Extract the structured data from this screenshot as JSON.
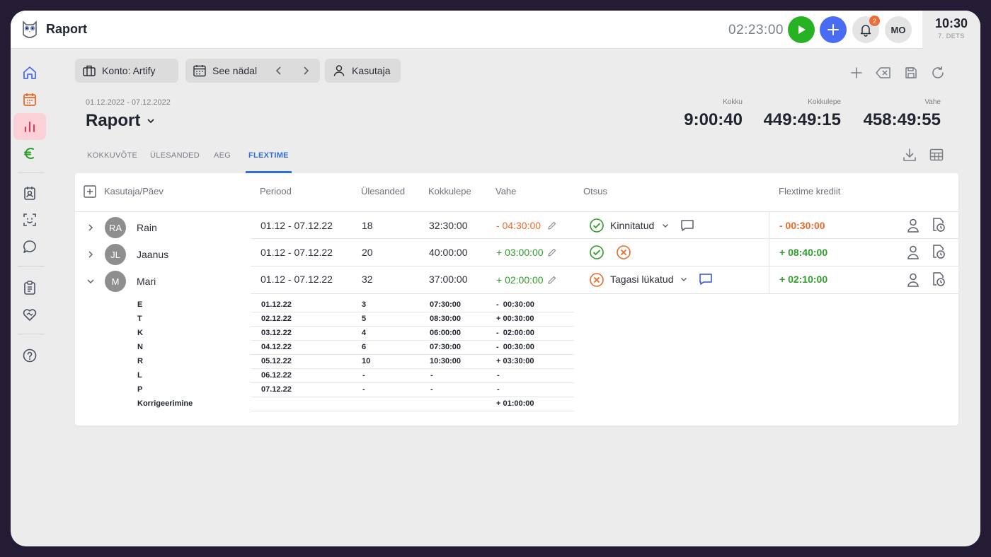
{
  "app": {
    "title": "Raport",
    "timer": "02:23:00",
    "notifications": "2",
    "user_initials": "MO",
    "clock_time": "10:30",
    "clock_date": "7. DETS"
  },
  "filters": {
    "account": "Konto: Artify",
    "period": "See nädal",
    "user": "Kasutaja"
  },
  "report": {
    "date_range": "01.12.2022 - 07.12.2022",
    "title": "Raport"
  },
  "stats": [
    {
      "label": "Kokku",
      "value": "9:00:40"
    },
    {
      "label": "Kokkulepe",
      "value": "449:49:15"
    },
    {
      "label": "Vahe",
      "value": "458:49:55"
    }
  ],
  "tabs": [
    "KOKKUVÕTE",
    "ÜLESANDED",
    "AEG",
    "FLEXTIME"
  ],
  "table": {
    "headers": {
      "user_day": "Kasutaja/Päev",
      "period": "Periood",
      "tasks": "Ülesanded",
      "agreement": "Kokkulepe",
      "diff": "Vahe",
      "decision": "Otsus",
      "credit": "Flextime krediit"
    },
    "rows": [
      {
        "initials": "RA",
        "name": "Rain",
        "period": "01.12 - 07.12.22",
        "tasks": "18",
        "agreement": "32:30:00",
        "diff": "- 04:30:00",
        "decision": "Kinnitatud",
        "credit": "- 00:30:00"
      },
      {
        "initials": "JL",
        "name": "Jaanus",
        "period": "01.12 - 07.12.22",
        "tasks": "20",
        "agreement": "40:00:00",
        "diff": "+ 03:00:00",
        "decision": "",
        "credit": "+ 08:40:00"
      },
      {
        "initials": "M",
        "name": "Mari",
        "period": "01.12 - 07.12.22",
        "tasks": "32",
        "agreement": "37:00:00",
        "diff": "+ 02:00:00",
        "decision": "Tagasi lükatud",
        "credit": "+ 02:10:00"
      }
    ],
    "days": [
      {
        "day": "E",
        "date": "01.12.22",
        "tasks": "3",
        "agreement": "07:30:00",
        "diff": "-  00:30:00"
      },
      {
        "day": "T",
        "date": "02.12.22",
        "tasks": "5",
        "agreement": "08:30:00",
        "diff": "+ 00:30:00"
      },
      {
        "day": "K",
        "date": "03.12.22",
        "tasks": "4",
        "agreement": "06:00:00",
        "diff": "-  02:00:00"
      },
      {
        "day": "N",
        "date": "04.12.22",
        "tasks": "6",
        "agreement": "07:30:00",
        "diff": "-  00:30:00"
      },
      {
        "day": "R",
        "date": "05.12.22",
        "tasks": "10",
        "agreement": "10:30:00",
        "diff": "+ 03:30:00"
      },
      {
        "day": "L",
        "date": "06.12.22",
        "tasks": "-",
        "agreement": "-",
        "diff": "-"
      },
      {
        "day": "P",
        "date": "07.12.22",
        "tasks": "-",
        "agreement": "-",
        "diff": "-"
      },
      {
        "day": "Korrigeerimine",
        "date": "",
        "tasks": "",
        "agreement": "",
        "diff": "+ 01:00:00"
      }
    ]
  },
  "colors": {
    "accent": "#2f6fd9",
    "positive": "#2e9e2a",
    "negative": "#ea6a2a",
    "play": "#27b224",
    "add": "#4a6cf2",
    "active_nav": "#fbd0d6"
  },
  "icons": {
    "sidebar": [
      "home-icon",
      "calendar-icon",
      "chart-icon",
      "euro-icon",
      "contact-card-icon",
      "face-scan-icon",
      "chat-icon",
      "clipboard-icon",
      "heart-handshake-icon",
      "help-icon"
    ]
  }
}
